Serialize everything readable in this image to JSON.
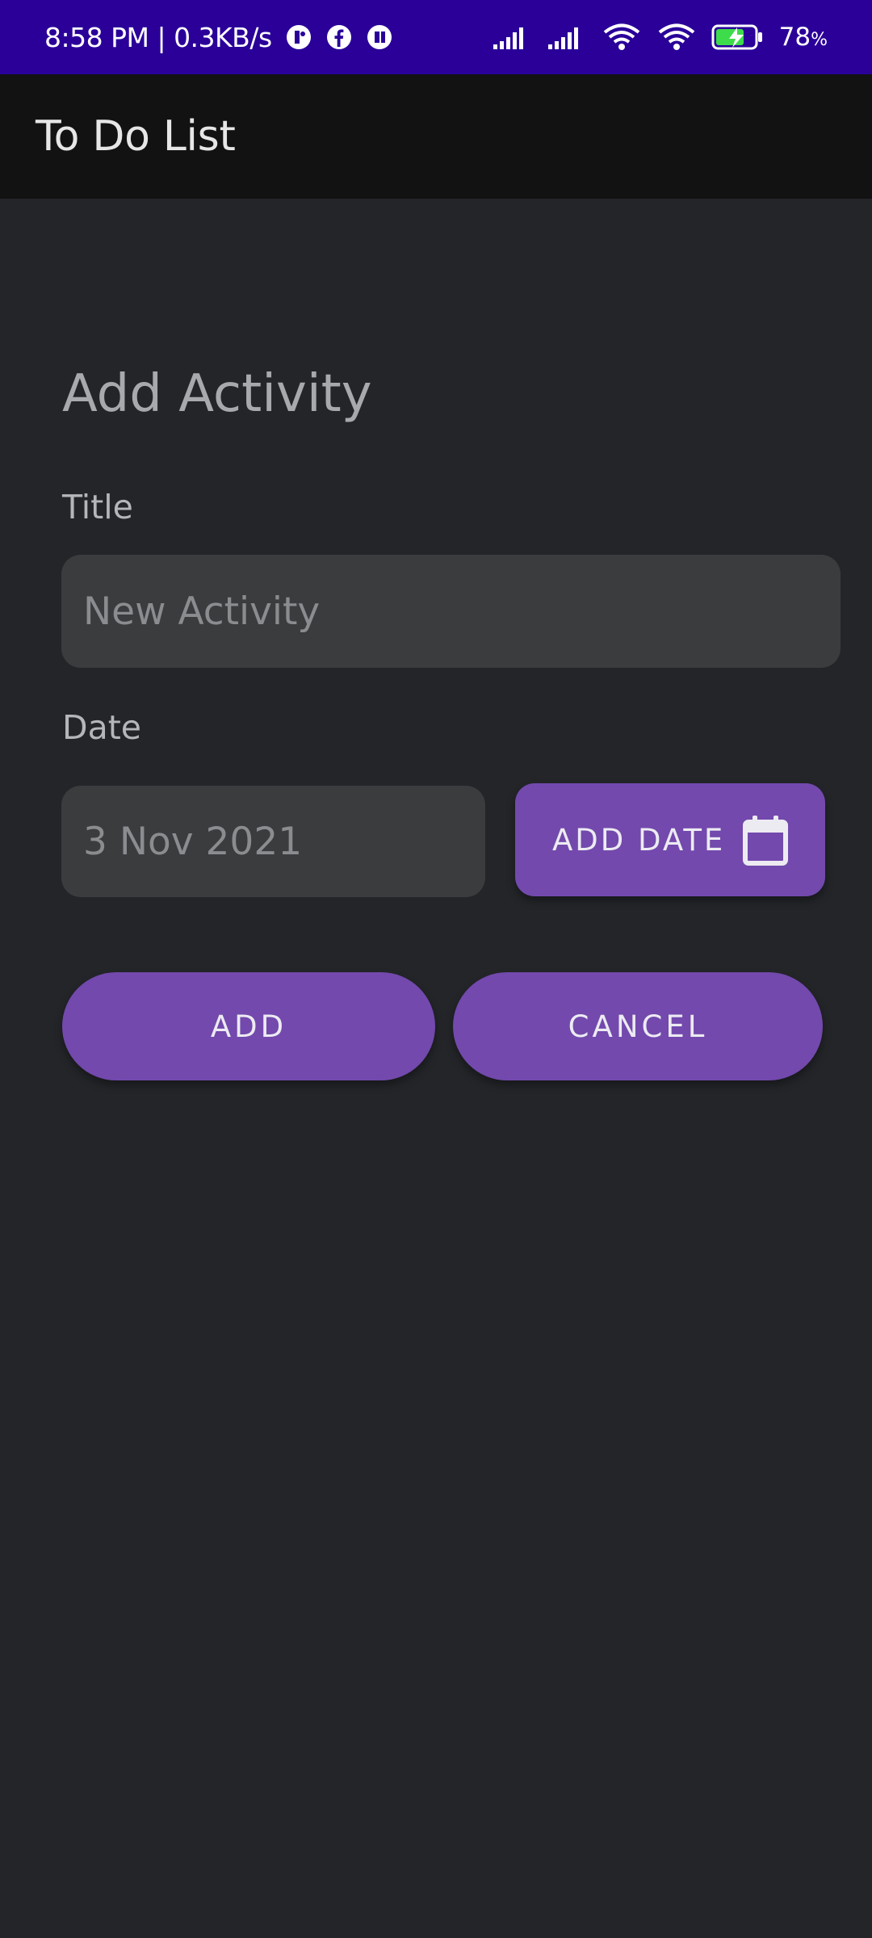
{
  "status_bar": {
    "time_speed": "8:58 PM | 0.3KB/s",
    "battery": "78",
    "battery_unit": "%",
    "icons": [
      "notification-icon",
      "facebook-icon",
      "notification-icon",
      "signal-icon",
      "signal-icon",
      "wifi-icon",
      "wifi-icon",
      "battery-charging-icon"
    ]
  },
  "app_bar": {
    "title": "To Do List"
  },
  "form": {
    "heading": "Add Activity",
    "title_label": "Title",
    "title_placeholder": "New Activity",
    "date_label": "Date",
    "date_value": "3 Nov 2021",
    "add_date_label": "ADD DATE",
    "add_label": "ADD",
    "cancel_label": "CANCEL"
  },
  "colors": {
    "status_bar": "#2a0099",
    "app_bar": "#121212",
    "background": "#232529",
    "accent": "#7349ad",
    "input_bg": "#3b3c3e"
  }
}
